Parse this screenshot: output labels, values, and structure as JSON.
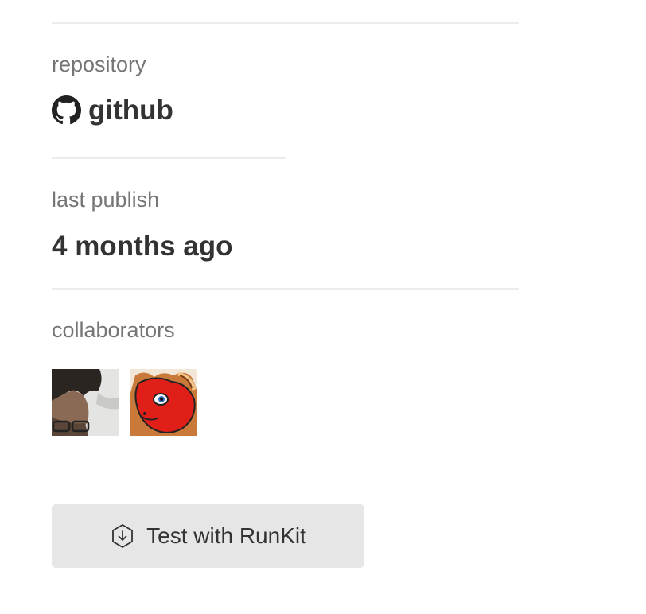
{
  "repository": {
    "label": "repository",
    "link_text": "github",
    "icon": "github-icon"
  },
  "last_publish": {
    "label": "last publish",
    "value": "4 months ago"
  },
  "collaborators": {
    "label": "collaborators",
    "avatars": [
      {
        "name": "collaborator-avatar-1"
      },
      {
        "name": "collaborator-avatar-2"
      }
    ]
  },
  "runkit": {
    "label": "Test with RunKit",
    "icon": "download-hexagon-icon"
  },
  "colors": {
    "label_gray": "#757575",
    "value_dark": "#333333",
    "divider": "#ececec",
    "button_bg": "#e6e6e6"
  }
}
